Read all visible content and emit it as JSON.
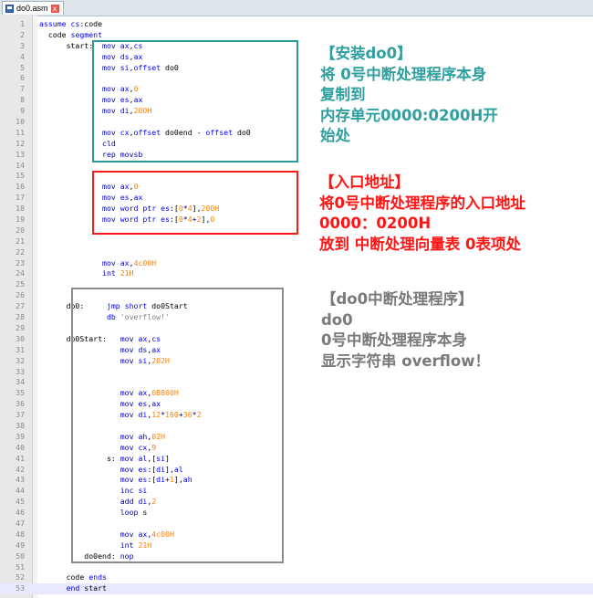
{
  "tab": {
    "filename": "do0.asm",
    "close_glyph": "x"
  },
  "code_lines": [
    [
      [
        "assume ",
        "kw"
      ],
      [
        "cs",
        "reg"
      ],
      [
        ":code",
        "plain"
      ]
    ],
    [
      [
        "  code ",
        "plain"
      ],
      [
        "segment",
        "kw"
      ]
    ],
    [
      [
        "      start:  ",
        "lab"
      ],
      [
        "mov ",
        "ins"
      ],
      [
        "ax",
        "reg"
      ],
      [
        ",",
        "plain"
      ],
      [
        "cs",
        "reg"
      ]
    ],
    [
      [
        "              ",
        "plain"
      ],
      [
        "mov ",
        "ins"
      ],
      [
        "ds",
        "reg"
      ],
      [
        ",",
        "plain"
      ],
      [
        "ax",
        "reg"
      ]
    ],
    [
      [
        "              ",
        "plain"
      ],
      [
        "mov ",
        "ins"
      ],
      [
        "si",
        "reg"
      ],
      [
        ",",
        "plain"
      ],
      [
        "offset ",
        "kw"
      ],
      [
        "do0",
        "plain"
      ]
    ],
    [],
    [
      [
        "              ",
        "plain"
      ],
      [
        "mov ",
        "ins"
      ],
      [
        "ax",
        "reg"
      ],
      [
        ",",
        "plain"
      ],
      [
        "0",
        "num"
      ]
    ],
    [
      [
        "              ",
        "plain"
      ],
      [
        "mov ",
        "ins"
      ],
      [
        "es",
        "reg"
      ],
      [
        ",",
        "plain"
      ],
      [
        "ax",
        "reg"
      ]
    ],
    [
      [
        "              ",
        "plain"
      ],
      [
        "mov ",
        "ins"
      ],
      [
        "di",
        "reg"
      ],
      [
        ",",
        "plain"
      ],
      [
        "200H",
        "num"
      ]
    ],
    [],
    [
      [
        "              ",
        "plain"
      ],
      [
        "mov ",
        "ins"
      ],
      [
        "cx",
        "reg"
      ],
      [
        ",",
        "plain"
      ],
      [
        "offset ",
        "kw"
      ],
      [
        "do0end ",
        "plain"
      ],
      [
        "- ",
        "op"
      ],
      [
        "offset ",
        "kw"
      ],
      [
        "do0",
        "plain"
      ]
    ],
    [
      [
        "              ",
        "plain"
      ],
      [
        "cld",
        "ins"
      ]
    ],
    [
      [
        "              ",
        "plain"
      ],
      [
        "rep movsb",
        "ins"
      ]
    ],
    [],
    [],
    [
      [
        "              ",
        "plain"
      ],
      [
        "mov ",
        "ins"
      ],
      [
        "ax",
        "reg"
      ],
      [
        ",",
        "plain"
      ],
      [
        "0",
        "num"
      ]
    ],
    [
      [
        "              ",
        "plain"
      ],
      [
        "mov ",
        "ins"
      ],
      [
        "es",
        "reg"
      ],
      [
        ",",
        "plain"
      ],
      [
        "ax",
        "reg"
      ]
    ],
    [
      [
        "              ",
        "plain"
      ],
      [
        "mov ",
        "ins"
      ],
      [
        "word ptr ",
        "kw"
      ],
      [
        "es",
        "reg"
      ],
      [
        ":[",
        "plain"
      ],
      [
        "0",
        "num"
      ],
      [
        "*",
        "op"
      ],
      [
        "4",
        "num"
      ],
      [
        "],",
        "plain"
      ],
      [
        "200H",
        "num"
      ]
    ],
    [
      [
        "              ",
        "plain"
      ],
      [
        "mov ",
        "ins"
      ],
      [
        "word ptr ",
        "kw"
      ],
      [
        "es",
        "reg"
      ],
      [
        ":[",
        "plain"
      ],
      [
        "0",
        "num"
      ],
      [
        "*",
        "op"
      ],
      [
        "4",
        "num"
      ],
      [
        "+",
        "op"
      ],
      [
        "2",
        "num"
      ],
      [
        "],",
        "plain"
      ],
      [
        "0",
        "num"
      ]
    ],
    [],
    [],
    [],
    [
      [
        "              ",
        "plain"
      ],
      [
        "mov ",
        "ins"
      ],
      [
        "ax",
        "reg"
      ],
      [
        ",",
        "plain"
      ],
      [
        "4c00H",
        "num"
      ]
    ],
    [
      [
        "              ",
        "plain"
      ],
      [
        "int ",
        "ins"
      ],
      [
        "21H",
        "num"
      ]
    ],
    [],
    [],
    [
      [
        "      do0:     ",
        "lab"
      ],
      [
        "jmp ",
        "ins"
      ],
      [
        "short ",
        "kw"
      ],
      [
        "do0Start",
        "plain"
      ]
    ],
    [
      [
        "               ",
        "plain"
      ],
      [
        "db ",
        "kw"
      ],
      [
        "'overflow!'",
        "str"
      ]
    ],
    [],
    [
      [
        "      do0Start:   ",
        "lab"
      ],
      [
        "mov ",
        "ins"
      ],
      [
        "ax",
        "reg"
      ],
      [
        ",",
        "plain"
      ],
      [
        "cs",
        "reg"
      ]
    ],
    [
      [
        "                  ",
        "plain"
      ],
      [
        "mov ",
        "ins"
      ],
      [
        "ds",
        "reg"
      ],
      [
        ",",
        "plain"
      ],
      [
        "ax",
        "reg"
      ]
    ],
    [
      [
        "                  ",
        "plain"
      ],
      [
        "mov ",
        "ins"
      ],
      [
        "si",
        "reg"
      ],
      [
        ",",
        "plain"
      ],
      [
        "202H",
        "num"
      ]
    ],
    [],
    [],
    [
      [
        "                  ",
        "plain"
      ],
      [
        "mov ",
        "ins"
      ],
      [
        "ax",
        "reg"
      ],
      [
        ",",
        "plain"
      ],
      [
        "0B800H",
        "num"
      ]
    ],
    [
      [
        "                  ",
        "plain"
      ],
      [
        "mov ",
        "ins"
      ],
      [
        "es",
        "reg"
      ],
      [
        ",",
        "plain"
      ],
      [
        "ax",
        "reg"
      ]
    ],
    [
      [
        "                  ",
        "plain"
      ],
      [
        "mov ",
        "ins"
      ],
      [
        "di",
        "reg"
      ],
      [
        ",",
        "plain"
      ],
      [
        "12",
        "num"
      ],
      [
        "*",
        "op"
      ],
      [
        "160",
        "num"
      ],
      [
        "+",
        "op"
      ],
      [
        "36",
        "num"
      ],
      [
        "*",
        "op"
      ],
      [
        "2",
        "num"
      ]
    ],
    [],
    [
      [
        "                  ",
        "plain"
      ],
      [
        "mov ",
        "ins"
      ],
      [
        "ah",
        "reg"
      ],
      [
        ",",
        "plain"
      ],
      [
        "02H",
        "num"
      ]
    ],
    [
      [
        "                  ",
        "plain"
      ],
      [
        "mov ",
        "ins"
      ],
      [
        "cx",
        "reg"
      ],
      [
        ",",
        "plain"
      ],
      [
        "9",
        "num"
      ]
    ],
    [
      [
        "               s: ",
        "lab"
      ],
      [
        "mov ",
        "ins"
      ],
      [
        "al",
        "reg"
      ],
      [
        ",[",
        "plain"
      ],
      [
        "si",
        "reg"
      ],
      [
        "]",
        "plain"
      ]
    ],
    [
      [
        "                  ",
        "plain"
      ],
      [
        "mov ",
        "ins"
      ],
      [
        "es",
        "reg"
      ],
      [
        ":[",
        "plain"
      ],
      [
        "di",
        "reg"
      ],
      [
        "],",
        "plain"
      ],
      [
        "al",
        "reg"
      ]
    ],
    [
      [
        "                  ",
        "plain"
      ],
      [
        "mov ",
        "ins"
      ],
      [
        "es",
        "reg"
      ],
      [
        ":[",
        "plain"
      ],
      [
        "di",
        "reg"
      ],
      [
        "+",
        "op"
      ],
      [
        "1",
        "num"
      ],
      [
        "],",
        "plain"
      ],
      [
        "ah",
        "reg"
      ]
    ],
    [
      [
        "                  ",
        "plain"
      ],
      [
        "inc ",
        "ins"
      ],
      [
        "si",
        "reg"
      ]
    ],
    [
      [
        "                  ",
        "plain"
      ],
      [
        "add ",
        "ins"
      ],
      [
        "di",
        "reg"
      ],
      [
        ",",
        "plain"
      ],
      [
        "2",
        "num"
      ]
    ],
    [
      [
        "                  ",
        "plain"
      ],
      [
        "loop ",
        "ins"
      ],
      [
        "s",
        "plain"
      ]
    ],
    [],
    [
      [
        "                  ",
        "plain"
      ],
      [
        "mov ",
        "ins"
      ],
      [
        "ax",
        "reg"
      ],
      [
        ",",
        "plain"
      ],
      [
        "4c00H",
        "num"
      ]
    ],
    [
      [
        "                  ",
        "plain"
      ],
      [
        "int ",
        "ins"
      ],
      [
        "21H",
        "num"
      ]
    ],
    [
      [
        "          do0end: ",
        "lab"
      ],
      [
        "nop",
        "ins"
      ]
    ],
    [],
    [
      [
        "      code ",
        "plain"
      ],
      [
        "ends",
        "kw"
      ]
    ],
    [
      [
        "      end ",
        "kw"
      ],
      [
        "start",
        "plain"
      ]
    ]
  ],
  "current_line": 53,
  "notes": {
    "install": [
      "【安装do0】",
      "将 0号中断处理程序本身",
      "复制到",
      "内存单元0000:0200H开",
      "始处"
    ],
    "entry": [
      "【入口地址】",
      "将0号中断处理程序的入口地址",
      "0000：0200H",
      "放到 中断处理向量表 0表项处"
    ],
    "do0": [
      "【do0中断处理程序】",
      "do0",
      "0号中断处理程序本身",
      "显示字符串 overflow！"
    ]
  },
  "colors": {
    "install": "#2fa0a0",
    "entry": "#ff1414",
    "do0": "#7a7a7a"
  }
}
